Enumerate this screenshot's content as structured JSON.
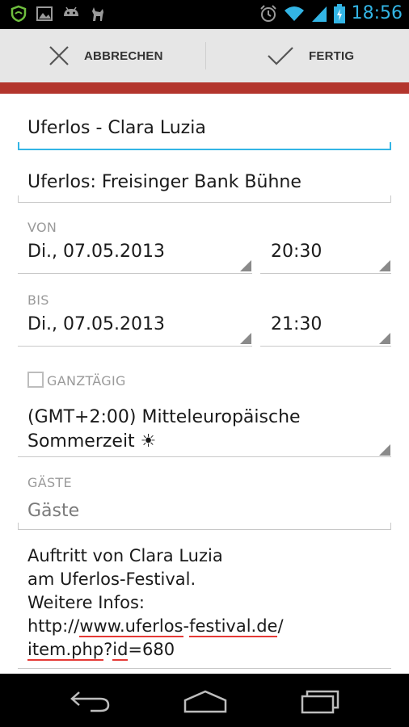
{
  "status_bar": {
    "time": "18:56",
    "icons": [
      "shield-icon",
      "gallery-icon",
      "android-icon",
      "deer-icon",
      "alarm-icon",
      "wifi-icon",
      "signal-icon",
      "battery-charging-icon"
    ]
  },
  "action_bar": {
    "cancel_label": "ABBRECHEN",
    "done_label": "FERTIG"
  },
  "form": {
    "title": "Uferlos - Clara Luzia",
    "location": "Uferlos: Freisinger Bank Bühne",
    "from": {
      "label": "VON",
      "date": "Di., 07.05.2013",
      "time": "20:30"
    },
    "to": {
      "label": "BIS",
      "date": "Di., 07.05.2013",
      "time": "21:30"
    },
    "all_day": {
      "label": "GANZTÄGIG",
      "checked": false
    },
    "timezone": {
      "line1": "(GMT+2:00) Mitteleuropäische",
      "line2": "Sommerzeit ☀"
    },
    "guests": {
      "label": "GÄSTE",
      "placeholder": "Gäste"
    },
    "description": {
      "line1": "Auftritt von Clara Luzia",
      "line2": "am Uferlos-Festival.",
      "line3": "Weitere Infos:",
      "line4a": "http://",
      "line4b": "www.uferlos",
      "line4c": "-",
      "line4d": "festival.de",
      "line4e": "/",
      "line5a": "item.php",
      "line5b": "?",
      "line5c": "id",
      "line5d": "=680"
    }
  },
  "nav_bar": {
    "icons": [
      "back-icon",
      "home-icon",
      "recents-icon"
    ]
  },
  "colors": {
    "accent": "#33b5e5",
    "event_color": "#b3352d",
    "spell_error": "#e53935"
  }
}
